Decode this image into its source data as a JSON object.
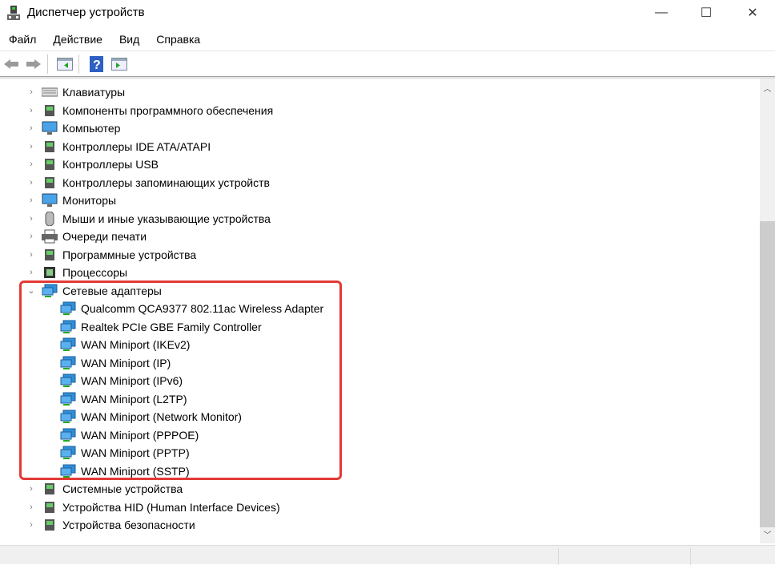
{
  "window": {
    "title": "Диспетчер устройств",
    "minimize": "—",
    "maximize": "☐",
    "close": "✕"
  },
  "menu": [
    "Файл",
    "Действие",
    "Вид",
    "Справка"
  ],
  "toolbar": {
    "icons": [
      "back-arrow-icon",
      "forward-arrow-icon",
      "show-hide-console-tree-icon",
      "help-icon",
      "action-pane-icon"
    ]
  },
  "tree": {
    "categories_before": [
      {
        "label": "Клавиатуры",
        "icon": "keyboard"
      },
      {
        "label": "Компоненты программного обеспечения",
        "icon": "software-component"
      },
      {
        "label": "Компьютер",
        "icon": "computer"
      },
      {
        "label": "Контроллеры IDE ATA/ATAPI",
        "icon": "ide"
      },
      {
        "label": "Контроллеры USB",
        "icon": "usb"
      },
      {
        "label": "Контроллеры запоминающих устройств",
        "icon": "storage"
      },
      {
        "label": "Мониторы",
        "icon": "monitor"
      },
      {
        "label": "Мыши и иные указывающие устройства",
        "icon": "mouse"
      },
      {
        "label": "Очереди печати",
        "icon": "printer"
      },
      {
        "label": "Программные устройства",
        "icon": "software-device"
      },
      {
        "label": "Процессоры",
        "icon": "processor"
      }
    ],
    "expanded": {
      "label": "Сетевые адаптеры",
      "icon": "network-adapter",
      "children": [
        "Qualcomm QCA9377 802.11ac Wireless Adapter",
        "Realtek PCIe GBE Family Controller",
        "WAN Miniport (IKEv2)",
        "WAN Miniport (IP)",
        "WAN Miniport (IPv6)",
        "WAN Miniport (L2TP)",
        "WAN Miniport (Network Monitor)",
        "WAN Miniport (PPPOE)",
        "WAN Miniport (PPTP)",
        "WAN Miniport (SSTP)"
      ]
    },
    "categories_after": [
      {
        "label": "Системные устройства",
        "icon": "system"
      },
      {
        "label": "Устройства HID (Human Interface Devices)",
        "icon": "hid"
      },
      {
        "label": "Устройства безопасности",
        "icon": "security"
      }
    ]
  },
  "colors": {
    "highlight": "#e23a35",
    "network_icon": "#2f8fd8"
  }
}
